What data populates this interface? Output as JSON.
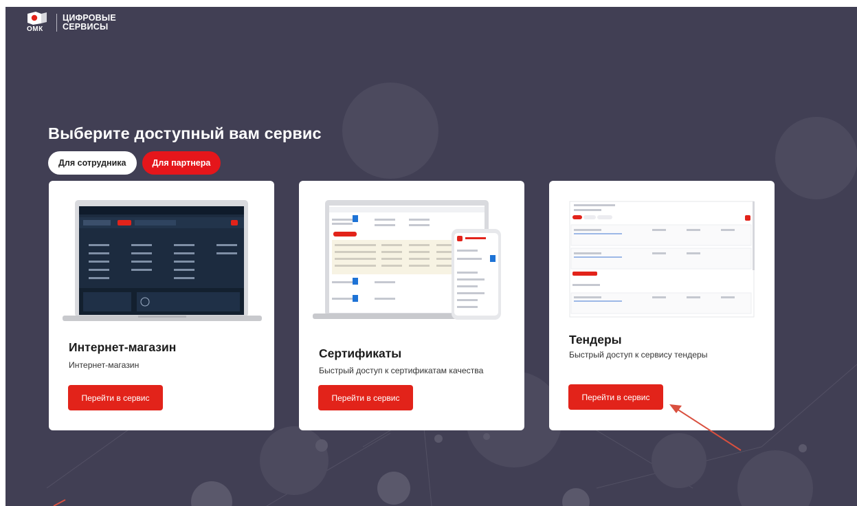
{
  "brand": {
    "sub": "ОМК",
    "name_line1": "ЦИФРОВЫЕ",
    "name_line2": "СЕРВИСЫ"
  },
  "headline": "Выберите доступный вам сервис",
  "tabs": [
    {
      "label": "Для сотрудника",
      "active": false
    },
    {
      "label": "Для партнера",
      "active": true
    }
  ],
  "cards": [
    {
      "title": "Интернет-магазин",
      "description": "Интернет-магазин",
      "button": "Перейти в сервис"
    },
    {
      "title": "Сертификаты",
      "description": "Быстрый доступ к сертификатам качества",
      "button": "Перейти в сервис"
    },
    {
      "title": "Тендеры",
      "description": "Быстрый доступ к сервису тендеры",
      "button": "Перейти в сервис"
    }
  ],
  "colors": {
    "background": "#413f54",
    "accent": "#e2231a",
    "card": "#ffffff",
    "annotation_arrow": "#d9503f"
  }
}
